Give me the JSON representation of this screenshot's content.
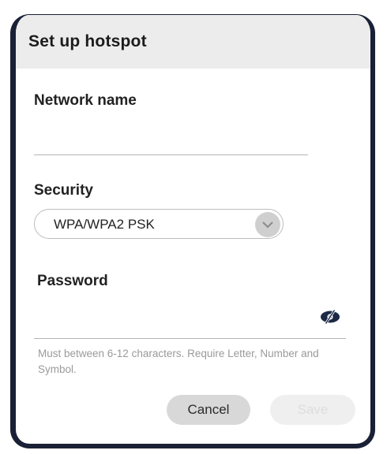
{
  "dialog": {
    "title": "Set up hotspot",
    "network_name": {
      "label": "Network name",
      "value": ""
    },
    "security": {
      "label": "Security",
      "selected": "WPA/WPA2 PSK"
    },
    "password": {
      "label": "Password",
      "value": "",
      "hint": "Must between 6-12 characters. Require Letter, Number and Symbol."
    },
    "buttons": {
      "cancel": "Cancel",
      "save": "Save"
    }
  },
  "icons": {
    "dropdown": "chevron-down-icon",
    "visibility": "eye-off-icon"
  },
  "colors": {
    "dialog_border": "#1a2035",
    "header_bg": "#ececec",
    "icon_dark": "#1c2845"
  }
}
